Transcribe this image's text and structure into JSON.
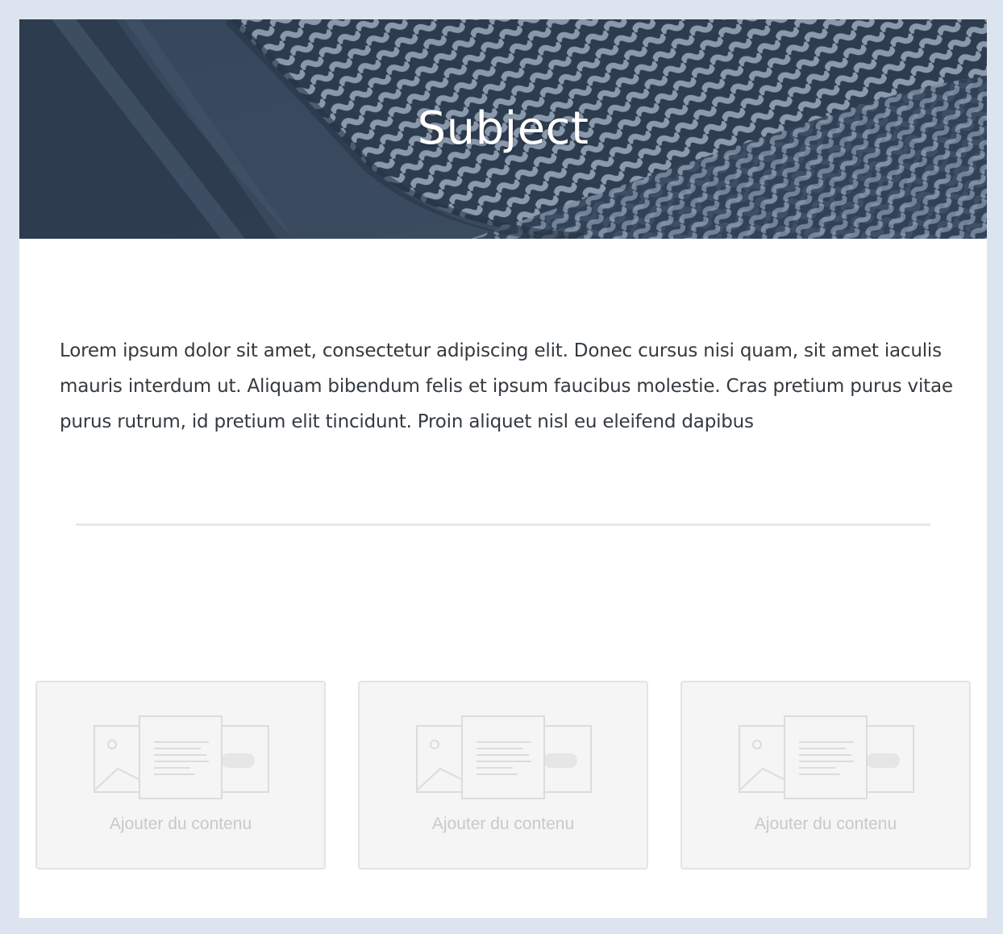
{
  "header": {
    "title": "Subject",
    "background_image": "woven-architecture-photo"
  },
  "content": {
    "paragraph": "Lorem ipsum dolor sit amet, consectetur adipiscing elit. Donec cursus nisi quam, sit amet iaculis mauris interdum ut. Aliquam bibendum felis et ipsum faucibus molestie. Cras pretium purus vitae purus rutrum, id pretium elit tincidunt. Proin aliquet nisl eu eleifend dapibus"
  },
  "placeholders": [
    {
      "label": "Ajouter du contenu",
      "icon": "add-content-icon"
    },
    {
      "label": "Ajouter du contenu",
      "icon": "add-content-icon"
    },
    {
      "label": "Ajouter du contenu",
      "icon": "add-content-icon"
    }
  ],
  "colors": {
    "page_background": "#dce5ef",
    "sheet_background": "#ffffff",
    "hero_dark": "#2e3b4e",
    "hero_light": "#9aabbf",
    "text": "#333a40",
    "divider": "#ebe6e6",
    "placeholder_bg": "#f5f5f5",
    "placeholder_border": "#e3e3e3",
    "placeholder_text": "#c9c9c9"
  }
}
